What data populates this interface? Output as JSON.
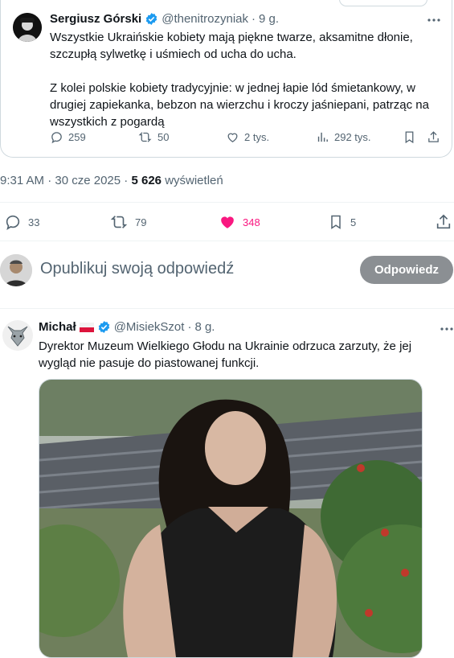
{
  "quoted": {
    "author_name": "Sergiusz Górski",
    "author_handle": "@thenitrozyniak",
    "time": "9 g.",
    "text_lines": [
      "Wszystkie Ukraińskie kobiety mają piękne twarze, aksamitne dłonie,",
      "szczupłą sylwetkę i uśmiech od ucha do ucha.",
      "Z kolei polskie kobiety tradycyjnie: w jednej łapie lód śmietankowy, w",
      "drugiej zapiekanka, bebzon na wierzchu i kroczy jaśniepani, patrząc na",
      "wszystkich z pogardą"
    ],
    "stats": {
      "replies": "259",
      "reposts": "50",
      "likes": "2 tys.",
      "views": "292 tys."
    }
  },
  "main": {
    "time": "9:31 AM",
    "date": "30 cze 2025",
    "views_count": "5 626",
    "views_label": "wyświetleń",
    "actions": {
      "replies": "33",
      "reposts": "79",
      "likes": "348",
      "bookmarks": "5"
    }
  },
  "composer": {
    "placeholder": "Opublikuj swoją odpowiedź",
    "button_label": "Odpowiedz"
  },
  "reply": {
    "author_name": "Michał",
    "author_handle": "@MisiekSzot",
    "time": "8 g.",
    "text_lines": [
      "Dyrektor Muzeum Wielkiego Głodu na Ukrainie odrzuca zarzuty, że jej",
      "wygląd nie pasuje do piastowanej funkcji."
    ]
  },
  "colors": {
    "like_pink": "#f91880",
    "verified_blue": "#1d9bf0",
    "muted": "#536471",
    "reply_button": "#8b8f93"
  }
}
